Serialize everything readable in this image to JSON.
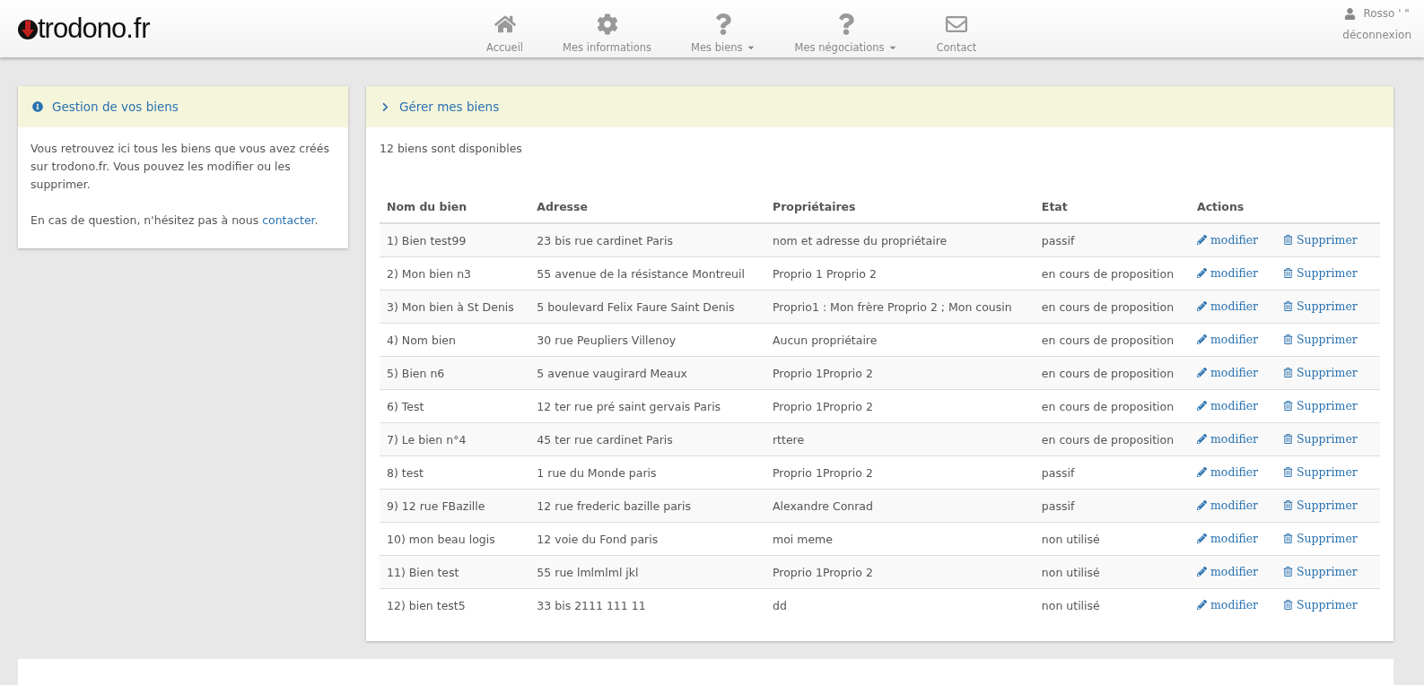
{
  "logo": {
    "name": "trodono",
    "suffix": ".fr"
  },
  "nav": [
    {
      "label": "Accueil",
      "dropdown": false
    },
    {
      "label": "Mes informations",
      "dropdown": false
    },
    {
      "label": "Mes biens",
      "dropdown": true
    },
    {
      "label": "Mes négociations",
      "dropdown": true
    },
    {
      "label": "Contact",
      "dropdown": false
    }
  ],
  "user": {
    "name": "Rosso ' \"",
    "logout": "déconnexion"
  },
  "info_panel": {
    "title": "Gestion de vos biens",
    "paragraph": "Vous retrouvez ici tous les biens que vous avez créés sur trodono.fr. Vous pouvez les modifier ou les supprimer.",
    "question": "En cas de question, n'hésitez pas à nous ",
    "link": "contacter",
    "after_link": "."
  },
  "main_panel": {
    "title": "Gérer mes biens",
    "count": "12 biens sont disponibles"
  },
  "table": {
    "columns": [
      "Nom du bien",
      "Adresse",
      "Propriétaires",
      "Etat",
      "Actions"
    ],
    "rows": [
      {
        "name": "1) Bien test99",
        "address": "23 bis rue cardinet Paris",
        "owners": "nom et adresse du propriétaire",
        "state": "passif",
        "edit": "modifier",
        "delete": "Supprimer"
      },
      {
        "name": "2) Mon bien n3",
        "address": "55 avenue de la résistance Montreuil",
        "owners": "Proprio 1 Proprio 2",
        "state": "en cours de proposition",
        "edit": "modifier",
        "delete": "Supprimer"
      },
      {
        "name": "3) Mon bien à St Denis",
        "address": "5 boulevard Felix Faure Saint Denis",
        "owners": "Proprio1 : Mon frère Proprio 2 ; Mon cousin",
        "state": "en cours de proposition",
        "edit": "modifier",
        "delete": "Supprimer"
      },
      {
        "name": "4) Nom bien",
        "address": "30 rue Peupliers Villenoy",
        "owners": "Aucun propriétaire",
        "state": "en cours de proposition",
        "edit": "modifier",
        "delete": "Supprimer"
      },
      {
        "name": "5) Bien n6",
        "address": "5 avenue vaugirard Meaux",
        "owners": "Proprio 1Proprio 2",
        "state": "en cours de proposition",
        "edit": "modifier",
        "delete": "Supprimer"
      },
      {
        "name": "6) Test",
        "address": "12 ter rue pré saint gervais Paris",
        "owners": "Proprio 1Proprio 2",
        "state": "en cours de proposition",
        "edit": "modifier",
        "delete": "Supprimer"
      },
      {
        "name": "7) Le bien n°4",
        "address": "45 ter rue cardinet Paris",
        "owners": "rttere",
        "state": "en cours de proposition",
        "edit": "modifier",
        "delete": "Supprimer"
      },
      {
        "name": "8) test",
        "address": "1 rue du Monde paris",
        "owners": "Proprio 1Proprio 2",
        "state": "passif",
        "edit": "modifier",
        "delete": "Supprimer"
      },
      {
        "name": "9) 12 rue FBazille",
        "address": "12 rue frederic bazille paris",
        "owners": "Alexandre Conrad",
        "state": "passif",
        "edit": "modifier",
        "delete": "Supprimer"
      },
      {
        "name": "10) mon beau logis",
        "address": "12 voie du Fond paris",
        "owners": "moi meme",
        "state": "non utilisé",
        "edit": "modifier",
        "delete": "Supprimer"
      },
      {
        "name": "11) Bien test",
        "address": "55 rue lmlmlml jkl",
        "owners": "Proprio 1Proprio 2",
        "state": "non utilisé",
        "edit": "modifier",
        "delete": "Supprimer"
      },
      {
        "name": "12) bien test5",
        "address": "33 bis 2111 111 11",
        "owners": "dd",
        "state": "non utilisé",
        "edit": "modifier",
        "delete": "Supprimer"
      }
    ]
  }
}
